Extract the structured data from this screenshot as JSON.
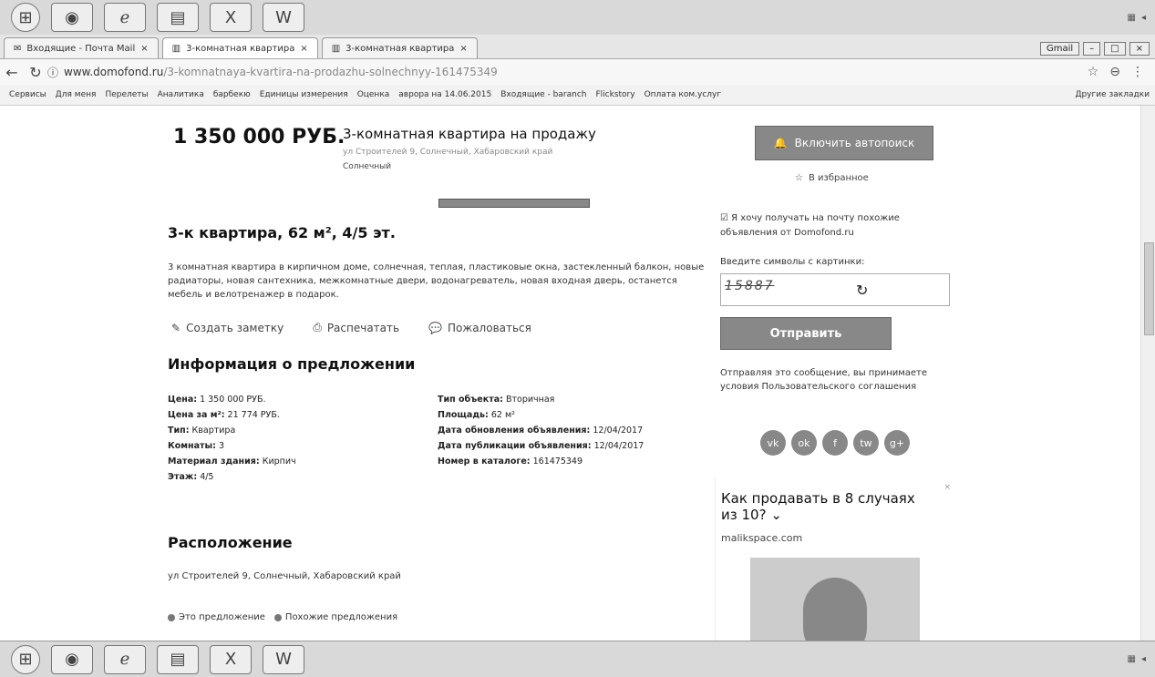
{
  "browser": {
    "tabs": [
      {
        "label": "Входящие - Почта Mail",
        "active": false
      },
      {
        "label": "3-комнатная квартира",
        "active": true
      },
      {
        "label": "3-комнатная квартира",
        "active": false
      }
    ],
    "user": "Gmail",
    "url_host": "www.domofond.ru",
    "url_path": "/3-komnatnaya-kvartira-na-prodazhu-solnechnyy-161475349",
    "bookmarks": [
      "Сервисы",
      "Для меня",
      "Перелеты",
      "Аналитика",
      "барбекю",
      "Единицы измерения",
      "Оценка",
      "аврора на 14.06.2015",
      "Входящие - baranch",
      "Flickstory",
      "Оплата ком.услуг"
    ],
    "other_bookmarks": "Другие закладки"
  },
  "listing": {
    "price": "1 350 000 РУБ.",
    "title": "3-комнатная квартира на продажу",
    "address": "ул Строителей 9, Солнечный, Хабаровский край",
    "locality": "Солнечный",
    "heading": "3-к квартира, 62 м², 4/5 эт.",
    "description": "3 комнатная квартира в кирпичном доме, солнечная, теплая, пластиковые окна, застекленный балкон, новые радиаторы, новая сантехника, межкомнатные двери, водонагреватель, новая входная дверь, останется мебель и велотренажер в подарок.",
    "actions": {
      "note": "Создать заметку",
      "print": "Распечатать",
      "complain": "Пожаловаться"
    }
  },
  "info": {
    "heading": "Информация о предложении",
    "left": [
      {
        "k": "Цена:",
        "v": "1 350 000 РУБ."
      },
      {
        "k": "Цена за м²:",
        "v": "21 774 РУБ."
      },
      {
        "k": "Тип:",
        "v": "Квартира"
      },
      {
        "k": "Комнаты:",
        "v": "3"
      },
      {
        "k": "Материал здания:",
        "v": "Кирпич"
      },
      {
        "k": "Этаж:",
        "v": "4/5"
      }
    ],
    "right": [
      {
        "k": "Тип объекта:",
        "v": "Вторичная"
      },
      {
        "k": "Площадь:",
        "v": "62 м²"
      },
      {
        "k": "Дата обновления объявления:",
        "v": "12/04/2017"
      },
      {
        "k": "Дата публикации объявления:",
        "v": "12/04/2017"
      },
      {
        "k": "Номер в каталоге:",
        "v": "161475349"
      }
    ]
  },
  "location": {
    "heading": "Расположение",
    "address": "ул Строителей 9, Солнечный, Хабаровский край",
    "this_offer": "Это предложение",
    "similar": "Похожие предложения"
  },
  "sidebar": {
    "autosearch": "Включить автопоиск",
    "favorites": "В избранное",
    "subscribe": "Я хочу получать на почту похожие объявления от Domofond.ru",
    "captcha_label": "Введите символы с картинки:",
    "captcha_text": "15887",
    "send": "Отправить",
    "terms": "Отправляя это сообщение, вы принимаете условия Пользовательского соглашения",
    "social": [
      "vk",
      "ok",
      "f",
      "tw",
      "g+"
    ]
  },
  "ad": {
    "title": "Как продавать в 8 случаях из 10?",
    "site": "malikspace.com"
  }
}
